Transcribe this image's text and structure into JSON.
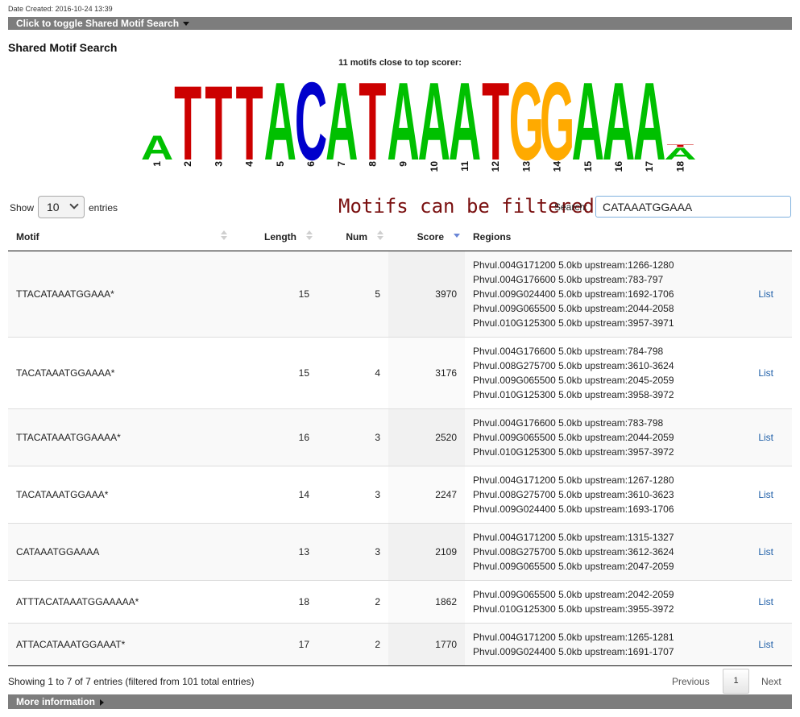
{
  "header": {
    "date_created": "Date Created: 2016-10-24 13:39",
    "toggle_label": "Click to toggle Shared Motif Search",
    "section_title": "Shared Motif Search"
  },
  "logo": {
    "caption": "11 motifs close to top scorer:",
    "colors": {
      "A": "#00c000",
      "C": "#0000cc",
      "G": "#ffaa00",
      "T": "#cc0000"
    },
    "positions": [
      {
        "label": "1",
        "stack": [
          {
            "base": "A",
            "h": 0.2
          }
        ]
      },
      {
        "label": "2",
        "stack": [
          {
            "base": "T",
            "h": 0.61
          }
        ]
      },
      {
        "label": "3",
        "stack": [
          {
            "base": "T",
            "h": 0.61
          }
        ]
      },
      {
        "label": "4",
        "stack": [
          {
            "base": "T",
            "h": 0.61
          }
        ]
      },
      {
        "label": "5",
        "stack": [
          {
            "base": "A",
            "h": 0.64
          }
        ]
      },
      {
        "label": "6",
        "stack": [
          {
            "base": "C",
            "h": 0.64
          }
        ]
      },
      {
        "label": "7",
        "stack": [
          {
            "base": "A",
            "h": 0.64
          }
        ]
      },
      {
        "label": "8",
        "stack": [
          {
            "base": "T",
            "h": 0.64
          }
        ]
      },
      {
        "label": "9",
        "stack": [
          {
            "base": "A",
            "h": 0.64
          }
        ]
      },
      {
        "label": "10",
        "stack": [
          {
            "base": "A",
            "h": 0.64
          }
        ]
      },
      {
        "label": "11",
        "stack": [
          {
            "base": "A",
            "h": 0.64
          }
        ]
      },
      {
        "label": "12",
        "stack": [
          {
            "base": "T",
            "h": 0.64
          }
        ]
      },
      {
        "label": "13",
        "stack": [
          {
            "base": "G",
            "h": 0.64
          }
        ]
      },
      {
        "label": "14",
        "stack": [
          {
            "base": "G",
            "h": 0.64
          }
        ]
      },
      {
        "label": "15",
        "stack": [
          {
            "base": "A",
            "h": 0.64
          }
        ]
      },
      {
        "label": "16",
        "stack": [
          {
            "base": "A",
            "h": 0.64
          }
        ]
      },
      {
        "label": "17",
        "stack": [
          {
            "base": "A",
            "h": 0.64
          }
        ]
      },
      {
        "label": "18",
        "stack": [
          {
            "base": "A",
            "h": 0.1
          },
          {
            "base": "T",
            "h": 0.02
          }
        ]
      }
    ]
  },
  "controls": {
    "show_label": "Show",
    "page_size": "10",
    "entries_label": "entries",
    "annotation": "Motifs can be filtered:",
    "search_label": "Search:",
    "search_value": "CATAAATGGAAA"
  },
  "table": {
    "columns": [
      "Motif",
      "Length",
      "Num",
      "Score",
      "Regions",
      ""
    ],
    "rows": [
      {
        "motif": "TTACATAAATGGAAA*",
        "length": "15",
        "num": "5",
        "score": "3970",
        "regions": [
          "Phvul.004G171200 5.0kb upstream:1266-1280",
          "Phvul.004G176600 5.0kb upstream:783-797",
          "Phvul.009G024400 5.0kb upstream:1692-1706",
          "Phvul.009G065500 5.0kb upstream:2044-2058",
          "Phvul.010G125300 5.0kb upstream:3957-3971"
        ],
        "action": "List"
      },
      {
        "motif": "TACATAAATGGAAAA*",
        "length": "15",
        "num": "4",
        "score": "3176",
        "regions": [
          "Phvul.004G176600 5.0kb upstream:784-798",
          "Phvul.008G275700 5.0kb upstream:3610-3624",
          "Phvul.009G065500 5.0kb upstream:2045-2059",
          "Phvul.010G125300 5.0kb upstream:3958-3972"
        ],
        "action": "List"
      },
      {
        "motif": "TTACATAAATGGAAAA*",
        "length": "16",
        "num": "3",
        "score": "2520",
        "regions": [
          "Phvul.004G176600 5.0kb upstream:783-798",
          "Phvul.009G065500 5.0kb upstream:2044-2059",
          "Phvul.010G125300 5.0kb upstream:3957-3972"
        ],
        "action": "List"
      },
      {
        "motif": "TACATAAATGGAAA*",
        "length": "14",
        "num": "3",
        "score": "2247",
        "regions": [
          "Phvul.004G171200 5.0kb upstream:1267-1280",
          "Phvul.008G275700 5.0kb upstream:3610-3623",
          "Phvul.009G024400 5.0kb upstream:1693-1706"
        ],
        "action": "List"
      },
      {
        "motif": "CATAAATGGAAAA",
        "length": "13",
        "num": "3",
        "score": "2109",
        "regions": [
          "Phvul.004G171200 5.0kb upstream:1315-1327",
          "Phvul.008G275700 5.0kb upstream:3612-3624",
          "Phvul.009G065500 5.0kb upstream:2047-2059"
        ],
        "action": "List"
      },
      {
        "motif": "ATTTACATAAATGGAAAAA*",
        "length": "18",
        "num": "2",
        "score": "1862",
        "regions": [
          "Phvul.009G065500 5.0kb upstream:2042-2059",
          "Phvul.010G125300 5.0kb upstream:3955-3972"
        ],
        "action": "List"
      },
      {
        "motif": "ATTACATAAATGGAAAT*",
        "length": "17",
        "num": "2",
        "score": "1770",
        "regions": [
          "Phvul.004G171200 5.0kb upstream:1265-1281",
          "Phvul.009G024400 5.0kb upstream:1691-1707"
        ],
        "action": "List"
      }
    ]
  },
  "footer": {
    "info": "Showing 1 to 7 of 7 entries (filtered from 101 total entries)",
    "previous": "Previous",
    "current_page": "1",
    "next": "Next",
    "more_info": "More information"
  }
}
